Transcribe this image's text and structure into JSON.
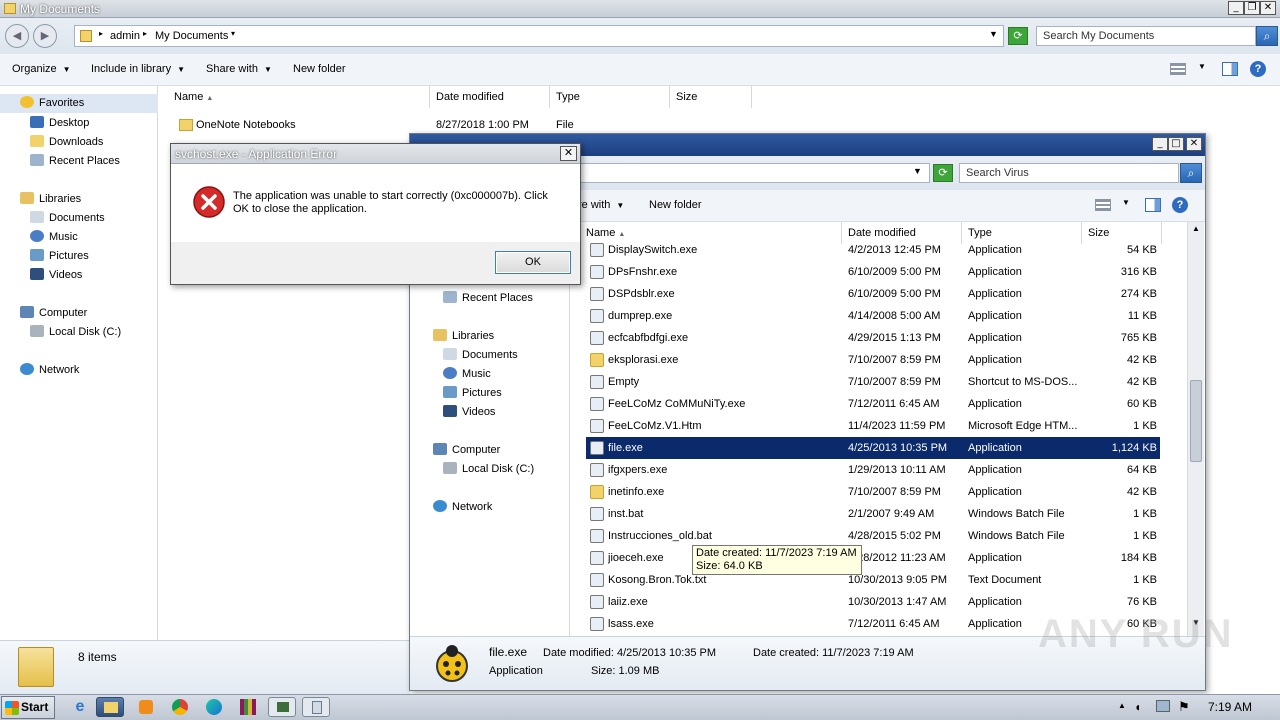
{
  "back_window": {
    "title": "My Documents",
    "breadcrumb": [
      "admin",
      "My Documents"
    ],
    "search_placeholder": "Search My Documents",
    "toolbar": [
      "Organize",
      "Include in library",
      "Share with",
      "New folder"
    ],
    "columns": [
      "Name",
      "Date modified",
      "Type",
      "Size"
    ],
    "row": {
      "name": "OneNote Notebooks",
      "date": "8/27/2018 1:00 PM",
      "type": "File folder",
      "size": ""
    },
    "nav": {
      "favorites": "Favorites",
      "favorites_items": [
        "Desktop",
        "Downloads",
        "Recent Places"
      ],
      "libraries": "Libraries",
      "libraries_items": [
        "Documents",
        "Music",
        "Pictures",
        "Videos"
      ],
      "computer": "Computer",
      "local_disk": "Local Disk (C:)",
      "network": "Network"
    },
    "status": "8 items"
  },
  "front_window": {
    "search_placeholder": "Search Virus",
    "toolbar": [
      "re with",
      "New folder"
    ],
    "columns": [
      "Name",
      "Date modified",
      "Type",
      "Size"
    ],
    "nav": {
      "recent": "Recent Places",
      "libraries": "Libraries",
      "libraries_items": [
        "Documents",
        "Music",
        "Pictures",
        "Videos"
      ],
      "computer": "Computer",
      "local_disk": "Local Disk (C:)",
      "network": "Network"
    },
    "files": [
      {
        "name": "DisplaySwitch.exe",
        "date": "4/2/2013 12:45 PM",
        "type": "Application",
        "size": "54 KB"
      },
      {
        "name": "DPsFnshr.exe",
        "date": "6/10/2009 5:00 PM",
        "type": "Application",
        "size": "316 KB"
      },
      {
        "name": "DSPdsblr.exe",
        "date": "6/10/2009 5:00 PM",
        "type": "Application",
        "size": "274 KB"
      },
      {
        "name": "dumprep.exe",
        "date": "4/14/2008 5:00 AM",
        "type": "Application",
        "size": "11 KB"
      },
      {
        "name": "ecfcabfbdfgi.exe",
        "date": "4/29/2015 1:13 PM",
        "type": "Application",
        "size": "765 KB"
      },
      {
        "name": "eksplorasi.exe",
        "date": "7/10/2007 8:59 PM",
        "type": "Application",
        "size": "42 KB"
      },
      {
        "name": "Empty",
        "date": "7/10/2007 8:59 PM",
        "type": "Shortcut to MS-DOS...",
        "size": "42 KB"
      },
      {
        "name": "FeeLCoMz CoMMuNiTy.exe",
        "date": "7/12/2011 6:45 AM",
        "type": "Application",
        "size": "60 KB"
      },
      {
        "name": "FeeLCoMz.V1.Htm",
        "date": "11/4/2023 11:59 PM",
        "type": "Microsoft Edge HTM...",
        "size": "1 KB"
      },
      {
        "name": "file.exe",
        "date": "4/25/2013 10:35 PM",
        "type": "Application",
        "size": "1,124 KB"
      },
      {
        "name": "ifgxpers.exe",
        "date": "1/29/2013 10:11 AM",
        "type": "Application",
        "size": "64 KB"
      },
      {
        "name": "inetinfo.exe",
        "date": "7/10/2007 8:59 PM",
        "type": "Application",
        "size": "42 KB"
      },
      {
        "name": "inst.bat",
        "date": "2/1/2007 9:49 AM",
        "type": "Windows Batch File",
        "size": "1 KB"
      },
      {
        "name": "Instrucciones_old.bat",
        "date": "4/28/2015 5:02 PM",
        "type": "Windows Batch File",
        "size": "1 KB"
      },
      {
        "name": "jioeceh.exe",
        "date": "4/28/2012 11:23 AM",
        "type": "Application",
        "size": "184 KB"
      },
      {
        "name": "Kosong.Bron.Tok.txt",
        "date": "10/30/2013 9:05 PM",
        "type": "Text Document",
        "size": "1 KB"
      },
      {
        "name": "laiiz.exe",
        "date": "10/30/2013 1:47 AM",
        "type": "Application",
        "size": "76 KB"
      },
      {
        "name": "lsass.exe",
        "date": "7/12/2011 6:45 AM",
        "type": "Application",
        "size": "60 KB"
      }
    ],
    "tooltip": {
      "line1": "Date created: 11/7/2023 7:19 AM",
      "line2": "Size: 64.0 KB"
    },
    "details": {
      "name": "file.exe",
      "type": "Application",
      "date_modified": "Date modified: 4/25/2013 10:35 PM",
      "date_created": "Date created: 11/7/2023 7:19 AM",
      "size": "Size: 1.09 MB"
    }
  },
  "dialog": {
    "title": "svchost.exe - Application Error",
    "message": "The application was unable to start correctly (0xc000007b). Click OK to close the application.",
    "ok": "OK"
  },
  "taskbar": {
    "start": "Start",
    "clock": "7:19 AM"
  },
  "watermark": "ANY RUN"
}
